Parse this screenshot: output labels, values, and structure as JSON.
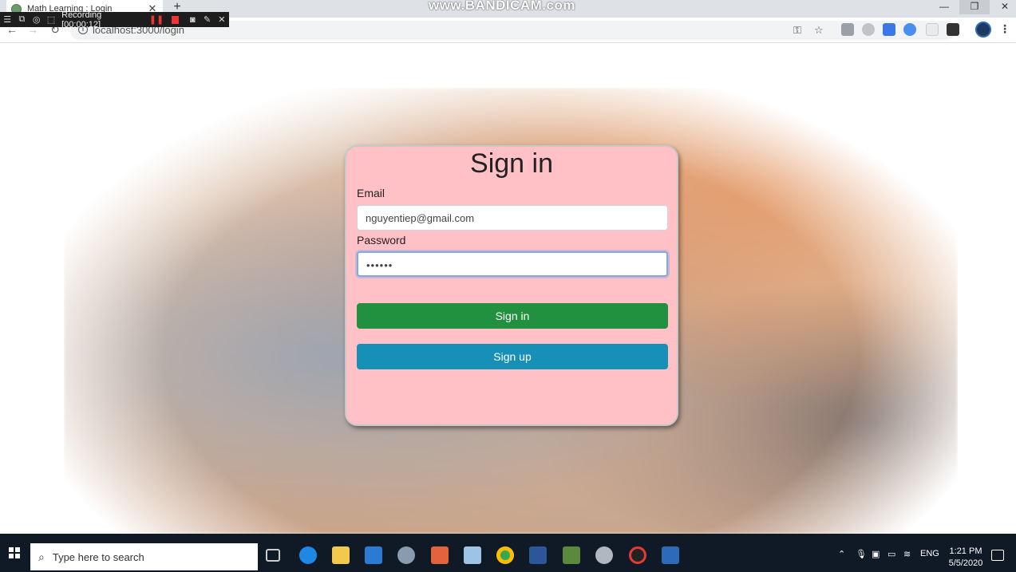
{
  "browser": {
    "tab_title": "Math Learning : Login",
    "new_tab_symbol": "+",
    "tab_close_symbol": "✕",
    "url": "localhost:3000/login",
    "watermark": "www.BANDICAM.com",
    "window_controls": {
      "minimize": "—",
      "maximize": "❐",
      "close": "✕"
    }
  },
  "recording": {
    "label": "Recording [00:00:12]"
  },
  "login_form": {
    "title": "Sign in",
    "email_label": "Email",
    "email_value": "nguyentiep@gmail.com",
    "password_label": "Password",
    "password_value": "••••••",
    "signin_button": "Sign in",
    "signup_button": "Sign up",
    "colors": {
      "card": "#ffc0c6",
      "signin": "#22913f",
      "signup": "#1790b8"
    }
  },
  "taskbar": {
    "search_placeholder": "Type here to search",
    "language": "ENG",
    "time": "1:21 PM",
    "date": "5/5/2020"
  }
}
